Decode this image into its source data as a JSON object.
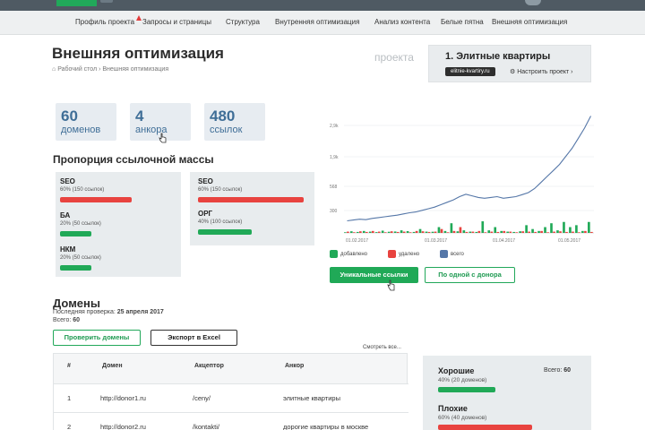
{
  "nav": {
    "items": [
      "Профиль проекта",
      "Запросы и страницы",
      "Структура",
      "Внутренняя оптимизация",
      "Анализ контента",
      "Белые пятна",
      "Внешняя оптимизация"
    ]
  },
  "page": {
    "title": "Внешняя оптимизация",
    "breadcrumb": "Рабочий стол › Внешняя оптимизация"
  },
  "project": {
    "label": "проекта",
    "name": "1. Элитные квартиры",
    "url": "elitnie-kvartiry.ru",
    "settings": "Настроить проект ›"
  },
  "stats": [
    {
      "num": "60",
      "label": "доменов"
    },
    {
      "num": "4",
      "label": "анкора"
    },
    {
      "num": "480",
      "label": "ссылок"
    }
  ],
  "proportion": {
    "title": "Пропорция ссылочной массы",
    "left": [
      {
        "name": "SEO",
        "sub": "60% (150 ссылок)",
        "fraction": 0.6,
        "color": "#e8433f"
      },
      {
        "name": "БА",
        "sub": "20% (50 ссылок)",
        "fraction": 0.2,
        "color": "#20a957"
      },
      {
        "name": "НКМ",
        "sub": "20% (50 ссылок)",
        "fraction": 0.2,
        "color": "#20a957"
      }
    ],
    "right": [
      {
        "name": "SEO",
        "sub": "60% (150 ссылок)",
        "fraction": 0.6,
        "color": "#e8433f"
      },
      {
        "name": "ОРГ",
        "sub": "40% (100 ссылок)",
        "fraction": 0.4,
        "color": "#20a957"
      }
    ]
  },
  "chart_data": {
    "type": "bar",
    "ytick_labels": [
      "2,9k",
      "1,9k",
      "568",
      "300"
    ],
    "x_tick_labels": [
      "01.02.2017",
      "01.03.2017",
      "01.04.2017",
      "01.05.2017"
    ],
    "series": [
      {
        "name": "добавлено",
        "color": "#20a957",
        "values": [
          10,
          25,
          15,
          30,
          20,
          12,
          35,
          18,
          22,
          40,
          28,
          15,
          60,
          20,
          18,
          90,
          30,
          150,
          25,
          40,
          20,
          15,
          180,
          40,
          90,
          30,
          20,
          15,
          25,
          120,
          60,
          30,
          90,
          150,
          40,
          170,
          90,
          120,
          30,
          170
        ]
      },
      {
        "name": "удалено",
        "color": "#e8433f",
        "values": [
          20,
          10,
          25,
          15,
          30,
          20,
          10,
          25,
          15,
          20,
          10,
          30,
          25,
          15,
          20,
          60,
          10,
          30,
          90,
          15,
          20,
          30,
          10,
          20,
          15,
          30,
          20,
          10,
          25,
          20,
          15,
          30,
          10,
          20,
          25,
          15,
          20,
          10,
          30,
          15
        ]
      },
      {
        "name": "всего",
        "color": "#5577a8",
        "values": [
          300,
          320,
          340,
          330,
          360,
          380,
          400,
          420,
          440,
          470,
          500,
          520,
          560,
          600,
          640,
          700,
          760,
          820,
          900,
          960,
          920,
          880,
          860,
          880,
          900,
          860,
          880,
          900,
          950,
          1000,
          1100,
          1250,
          1400,
          1550,
          1700,
          1900,
          2100,
          2350,
          2600,
          2900
        ]
      }
    ],
    "ylim": [
      0,
      3000
    ]
  },
  "legend": {
    "added": "добавлено",
    "removed": "удалено",
    "total": "всего"
  },
  "buttons": {
    "unique": "Уникальные ссылки",
    "one_per_donor": "По одной с донора",
    "check_domains": "Проверить домены",
    "export": "Экспорт в Excel",
    "see_all": "Смотреть все..."
  },
  "domains": {
    "title": "Домены",
    "last_check_label": "Последняя проверка:",
    "last_check_date": "25 апреля 2017",
    "total_label": "Всего:",
    "total": "60",
    "headers": [
      "#",
      "Домен",
      "Акцептор",
      "Анкор"
    ],
    "rows": [
      [
        "1",
        "http://donor1.ru",
        "/ceny/",
        "элитные квартиры"
      ],
      [
        "2",
        "http://donor2.ru",
        "/kontakti/",
        "дорогие квартиры в москве"
      ]
    ]
  },
  "quality": {
    "total_label": "Всего:",
    "total": "60",
    "items": [
      {
        "name": "Хорошие",
        "sub": "40% (20 доменов)",
        "fraction": 0.4,
        "color": "#20a957"
      },
      {
        "name": "Плохие",
        "sub": "60% (40 доменов)",
        "fraction": 0.6,
        "color": "#e8433f"
      }
    ]
  }
}
